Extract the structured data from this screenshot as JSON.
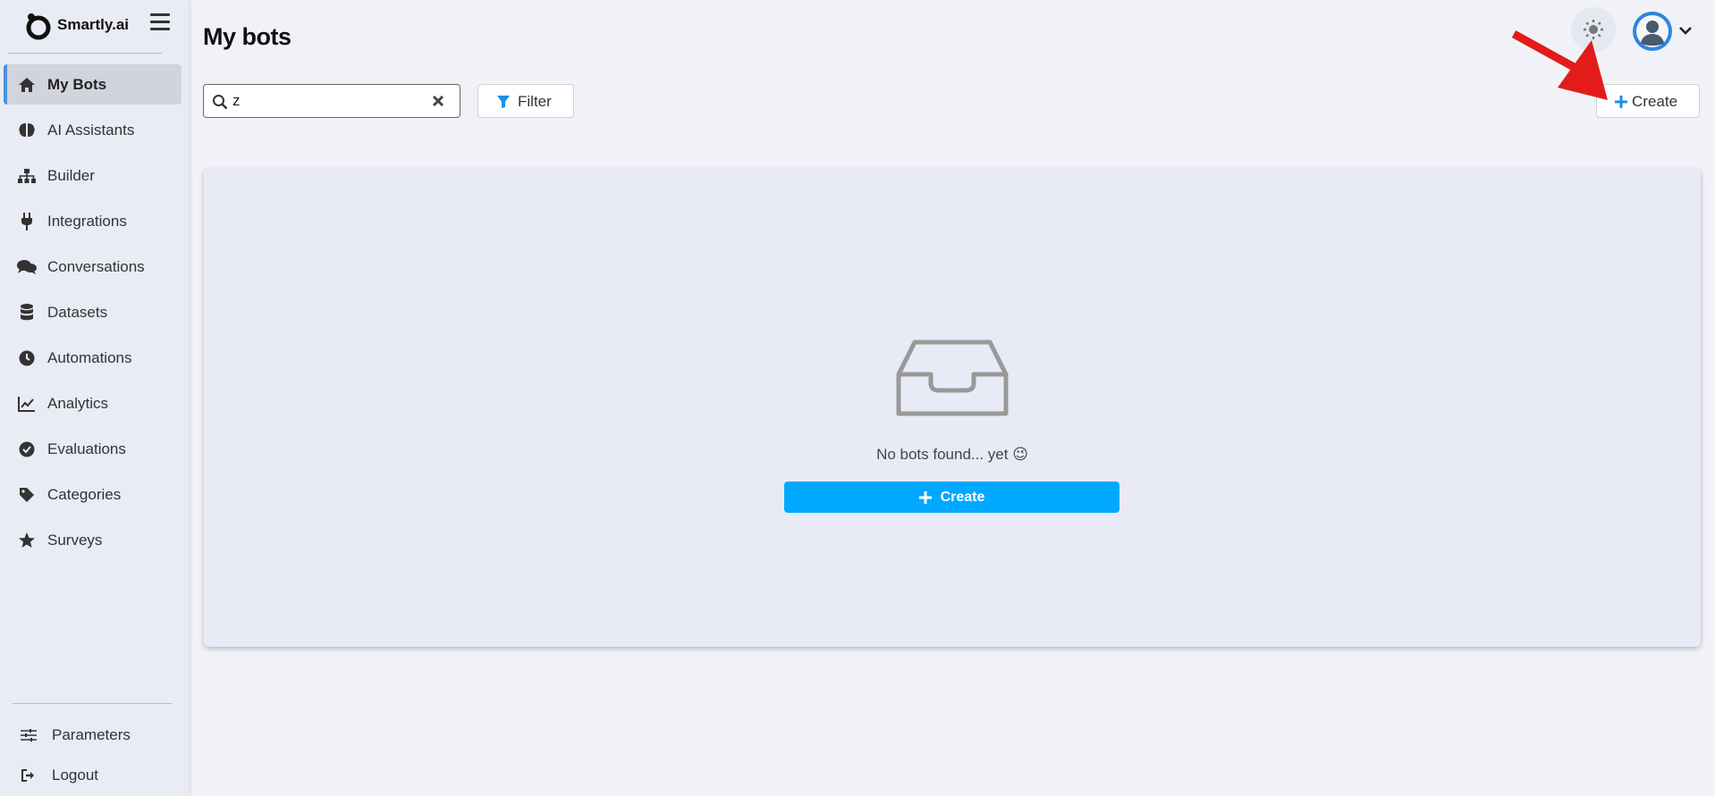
{
  "app": {
    "brand": "Smartly.ai"
  },
  "sidebar": {
    "items": [
      {
        "label": "My Bots",
        "icon": "home-icon",
        "active": true
      },
      {
        "label": "AI Assistants",
        "icon": "brain-icon"
      },
      {
        "label": "Builder",
        "icon": "sitemap-icon"
      },
      {
        "label": "Integrations",
        "icon": "plug-icon"
      },
      {
        "label": "Conversations",
        "icon": "comments-icon"
      },
      {
        "label": "Datasets",
        "icon": "database-icon"
      },
      {
        "label": "Automations",
        "icon": "clock-icon"
      },
      {
        "label": "Analytics",
        "icon": "chart-line-icon"
      },
      {
        "label": "Evaluations",
        "icon": "check-circle-icon"
      },
      {
        "label": "Categories",
        "icon": "tag-icon"
      },
      {
        "label": "Surveys",
        "icon": "star-icon"
      }
    ],
    "bottom": [
      {
        "label": "Parameters",
        "icon": "sliders-icon"
      },
      {
        "label": "Logout",
        "icon": "logout-icon"
      }
    ]
  },
  "header": {
    "title": "My bots"
  },
  "toolbar": {
    "search_value": "z",
    "filter_label": "Filter",
    "create_label": "Create"
  },
  "empty_state": {
    "message": "No bots found... yet 😉",
    "create_label": "Create"
  },
  "colors": {
    "accent": "#00a8ff",
    "active_indicator": "#4a90d9",
    "annotation_arrow": "#e31b1b"
  }
}
